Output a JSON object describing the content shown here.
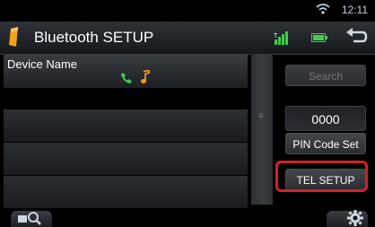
{
  "status": {
    "time": "12:11"
  },
  "header": {
    "title": "Bluetooth SETUP"
  },
  "list": {
    "column_label": "Device Name"
  },
  "side": {
    "search_label": "Search",
    "pin_value": "0000",
    "pin_set_label": "PIN Code Set",
    "tel_setup_label": "TEL SETUP"
  },
  "colors": {
    "highlight": "#d6202a",
    "phone_icon": "#3ecf4a",
    "music_icon": "#f39a1e",
    "bt_badge": "#f0a21b"
  }
}
